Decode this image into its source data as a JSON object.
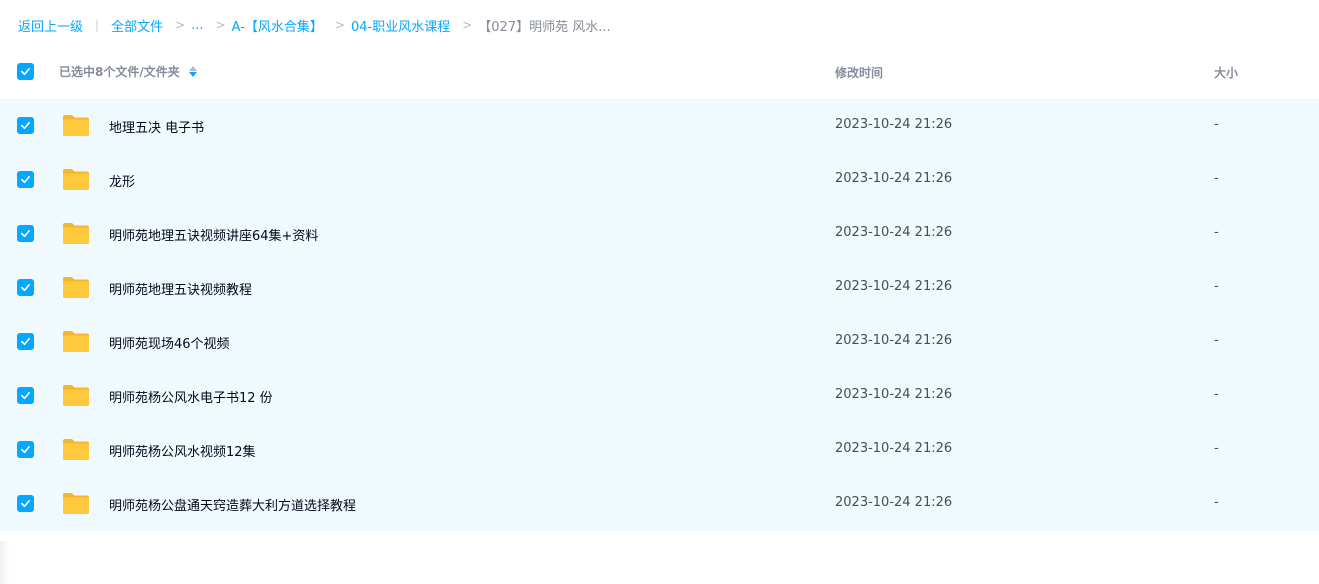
{
  "breadcrumb": {
    "back": "返回上一级",
    "all_files": "全部文件",
    "ellipsis": "...",
    "level1": "A-【风水合集】",
    "level2": "04-职业风水课程",
    "current": "【027】明师苑 风水..."
  },
  "header": {
    "selected_label": "已选中8个文件/文件夹",
    "time_label": "修改时间",
    "size_label": "大小"
  },
  "colors": {
    "accent": "#06a7ff",
    "row_bg": "#f0f9fe",
    "folder": "#ffc93d"
  },
  "files": [
    {
      "name": "地理五决 电子书",
      "modified": "2023-10-24 21:26",
      "size": "-"
    },
    {
      "name": "龙形",
      "modified": "2023-10-24 21:26",
      "size": "-"
    },
    {
      "name": "明师苑地理五诀视频讲座64集+资料",
      "modified": "2023-10-24 21:26",
      "size": "-"
    },
    {
      "name": "明师苑地理五诀视频教程",
      "modified": "2023-10-24 21:26",
      "size": "-"
    },
    {
      "name": "明师苑现场46个视频",
      "modified": "2023-10-24 21:26",
      "size": "-"
    },
    {
      "name": "明师苑杨公风水电子书12 份",
      "modified": "2023-10-24 21:26",
      "size": "-"
    },
    {
      "name": "明师苑杨公风水视频12集",
      "modified": "2023-10-24 21:26",
      "size": "-"
    },
    {
      "name": "明师苑杨公盘通天窍造葬大利方道选择教程",
      "modified": "2023-10-24 21:26",
      "size": "-"
    }
  ]
}
